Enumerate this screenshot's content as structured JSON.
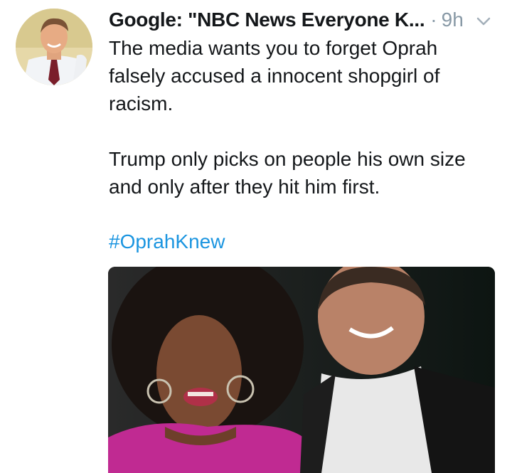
{
  "tweet": {
    "author_name": "Google: \"NBC News Everyone K...",
    "separator": "·",
    "time": "9h",
    "text_paragraph_1": "The media wants you to forget Oprah falsely accused a innocent shopgirl of racism.",
    "text_paragraph_2": "Trump only picks on people his own size and only after they hit him first.",
    "hashtag": "#OprahKnew"
  },
  "icons": {
    "menu": "chevron-down-icon"
  },
  "colors": {
    "text": "#14171a",
    "muted": "#8899a6",
    "link": "#1b95e0",
    "background": "#ffffff"
  }
}
